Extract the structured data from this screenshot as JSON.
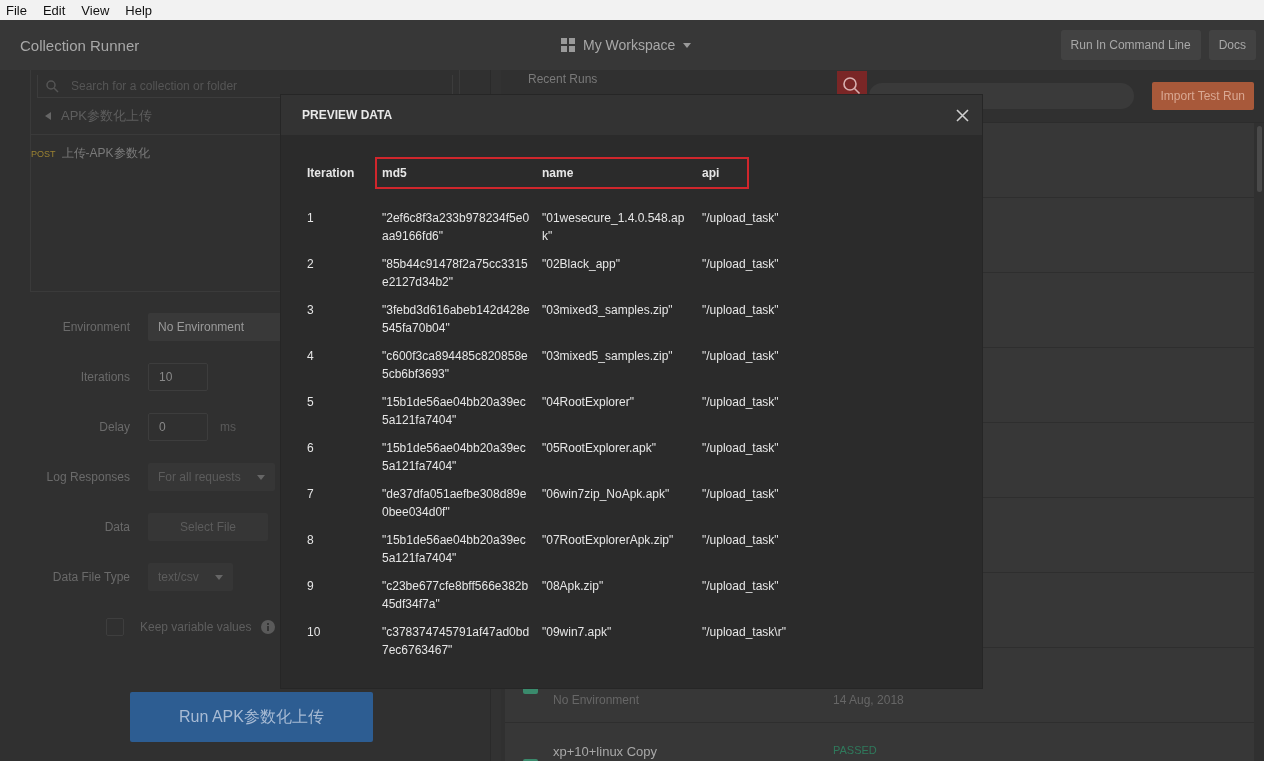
{
  "menu": [
    "File",
    "Edit",
    "View",
    "Help"
  ],
  "header": {
    "title": "Collection Runner",
    "workspace": "My Workspace",
    "buttons": [
      "Run In Command Line",
      "Docs"
    ]
  },
  "sidebar": {
    "search": {
      "placeholder": "Search for a collection or folder"
    },
    "collection": "APK参数化上传",
    "requests": [
      {
        "method": "POST",
        "name": "上传-APK参数化"
      }
    ]
  },
  "settings": [
    {
      "kind": "field",
      "label": "Environment",
      "value": "No Environment"
    },
    {
      "kind": "input",
      "label": "Iterations",
      "value": "10"
    },
    {
      "kind": "input",
      "label": "Delay",
      "value": "0",
      "unit": "ms"
    },
    {
      "kind": "select",
      "label": "Log Responses",
      "value": "For all requests"
    },
    {
      "kind": "button",
      "label": "Data",
      "value": "Select File"
    },
    {
      "kind": "select",
      "label": "Data File Type",
      "value": "text/csv"
    },
    {
      "kind": "checkbox",
      "label": "Keep variable values",
      "checked": false
    }
  ],
  "run_button": "Run APK参数化上传",
  "recent_runs": {
    "title": "Recent Runs",
    "import_button": "Import Test Run",
    "runs": [
      {
        "environment": "No Environment",
        "date": "14 Aug, 2018"
      },
      {
        "title": "xp+10+linux Copy",
        "status": "PASSED"
      }
    ]
  },
  "modal": {
    "title": "PREVIEW DATA",
    "columns": [
      "Iteration",
      "md5",
      "name",
      "api"
    ],
    "rows": [
      [
        "1",
        "\"2ef6c8f3a233b978234f5e0aa9166fd6\"",
        "\"01wesecure_1.4.0.548.apk\"",
        "\"/upload_task\""
      ],
      [
        "2",
        "\"85b44c91478f2a75cc3315e2127d34b2\"",
        "\"02Black_app\"",
        "\"/upload_task\""
      ],
      [
        "3",
        "\"3febd3d616abeb142d428e545fa70b04\"",
        "\"03mixed3_samples.zip\"",
        "\"/upload_task\""
      ],
      [
        "4",
        "\"c600f3ca894485c820858e5cb6bf3693\"",
        "\"03mixed5_samples.zip\"",
        "\"/upload_task\""
      ],
      [
        "5",
        "\"15b1de56ae04bb20a39ec5a121fa7404\"",
        "\"04RootExplorer\"",
        "\"/upload_task\""
      ],
      [
        "6",
        "\"15b1de56ae04bb20a39ec5a121fa7404\"",
        "\"05RootExplorer.apk\"",
        "\"/upload_task\""
      ],
      [
        "7",
        "\"de37dfa051aefbe308d89e0bee034d0f\"",
        "\"06win7zip_NoApk.apk\"",
        "\"/upload_task\""
      ],
      [
        "8",
        "\"15b1de56ae04bb20a39ec5a121fa7404\"",
        "\"07RootExplorerApk.zip\"",
        "\"/upload_task\""
      ],
      [
        "9",
        "\"c23be677cfe8bff566e382b45df34f7a\"",
        "\"08Apk.zip\"",
        "\"/upload_task\""
      ],
      [
        "10",
        "\"c378374745791af47ad0bd7ec6763467\"",
        "\"09win7.apk\"",
        "\"/upload_task\\r\""
      ]
    ]
  }
}
